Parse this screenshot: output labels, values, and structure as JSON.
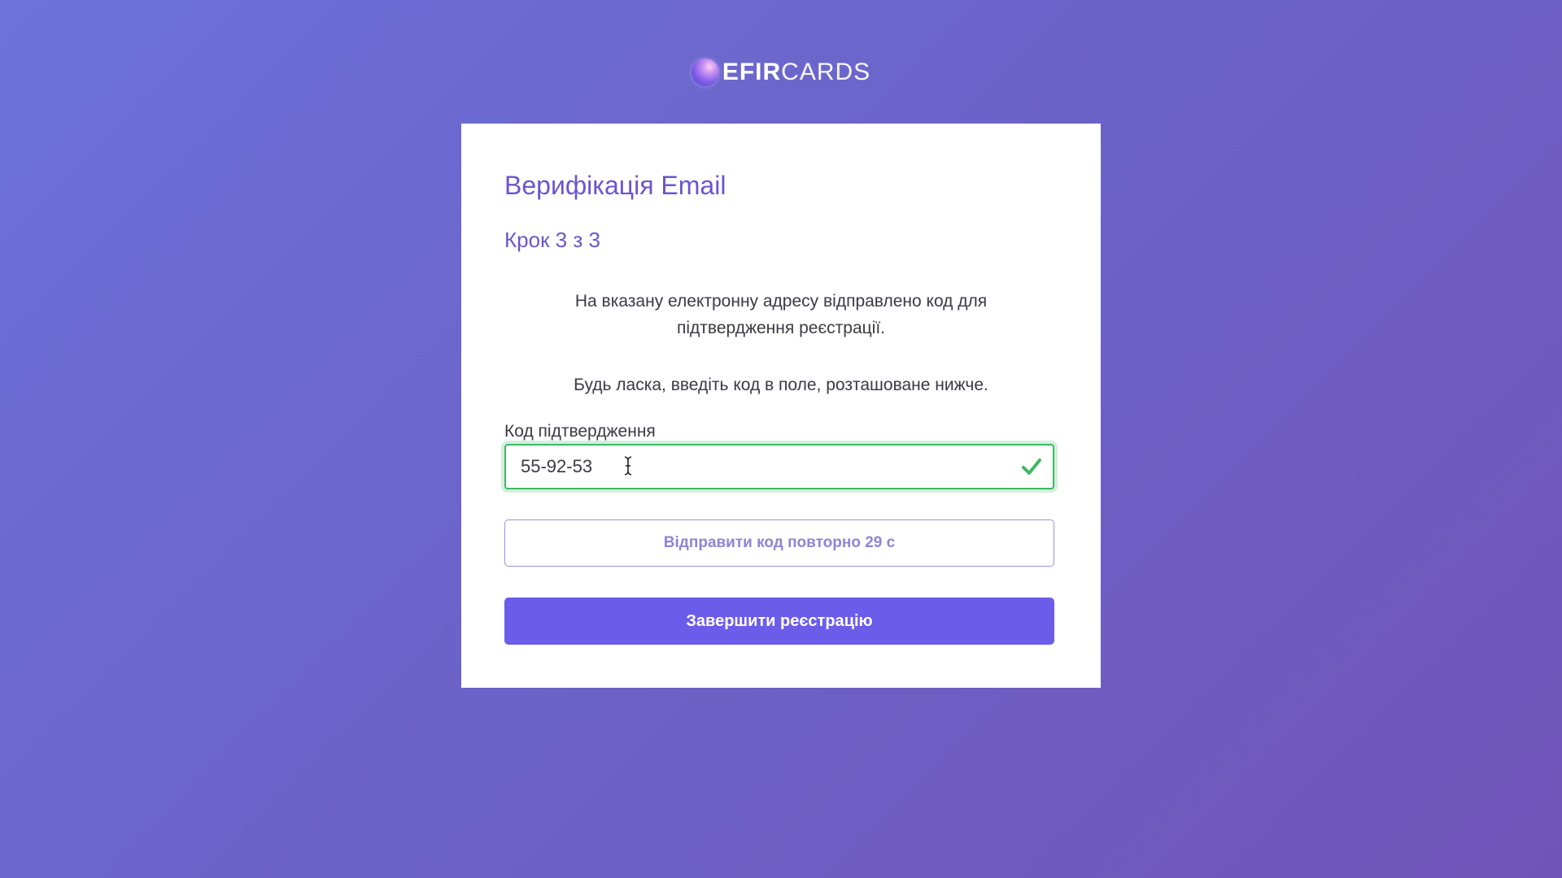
{
  "logo": {
    "strong": "EFIR",
    "light": "CARDS"
  },
  "card": {
    "title": "Верифікація Email",
    "step": "Крок 3 з 3",
    "description_line1": "На вказану електронну адресу відправлено код для",
    "description_line2": "підтвердження реєстрації.",
    "instruction": "Будь ласка, введіть код в поле, розташоване нижче."
  },
  "form": {
    "code_label": "Код підтвердження",
    "code_value": "55-92-53",
    "code_status": "valid",
    "resend_label": "Відправити код повторно 29 с",
    "submit_label": "Завершити реєстрацію"
  },
  "colors": {
    "accent": "#6b55cf",
    "primary_button": "#6b5cea",
    "valid": "#3db864"
  },
  "icons": {
    "logo": "logo-orb-icon",
    "status": "check-icon",
    "cursor": "text-cursor-icon"
  }
}
